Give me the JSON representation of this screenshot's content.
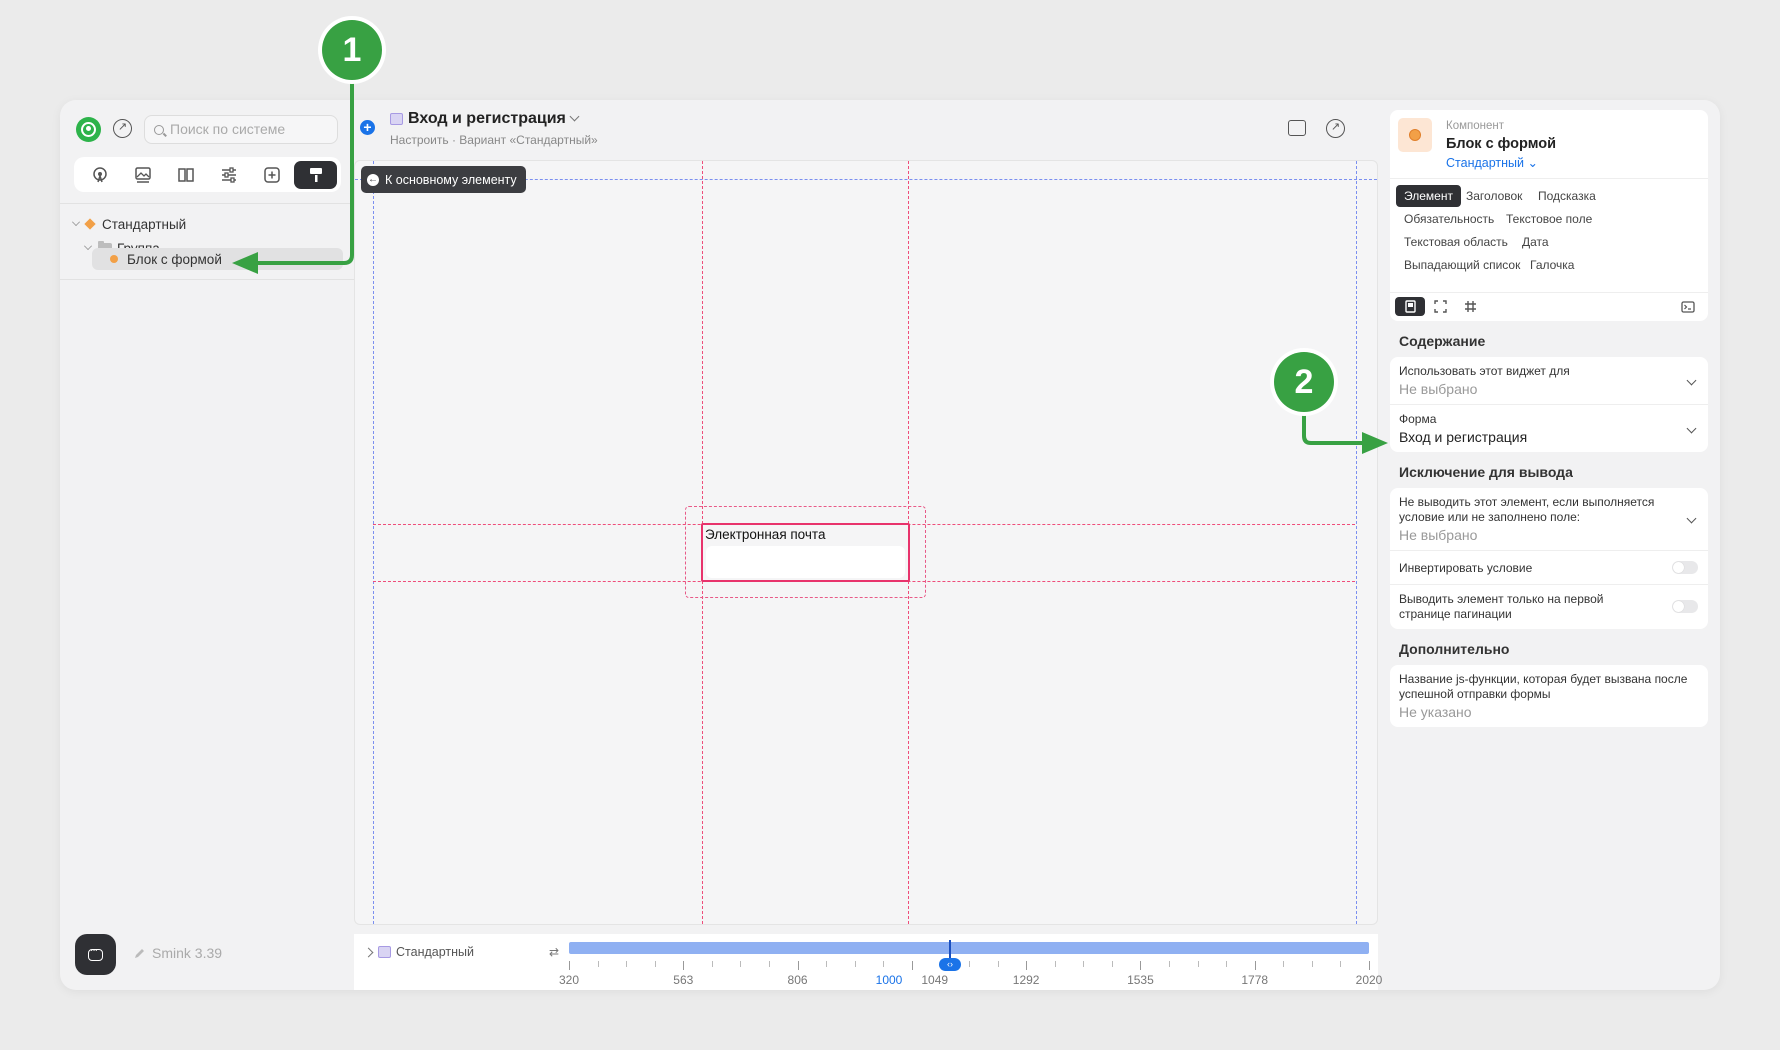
{
  "sidebar": {
    "search_placeholder": "Поиск по системе",
    "tree": [
      {
        "label": "Стандартный"
      },
      {
        "label": "Группа"
      },
      {
        "label": "Блок с формой"
      }
    ],
    "version": "Smink 3.39"
  },
  "header": {
    "title": "Вход и регистрация",
    "breadcrumb": "Настроить · Вариант «Стандартный»"
  },
  "canvas": {
    "back_button": "К основному элементу",
    "field_label": "Электронная почта"
  },
  "breakpoints": {
    "variant_label": "Стандартный",
    "ticks": [
      "320",
      "563",
      "806",
      "1000",
      "1049",
      "1292",
      "1535",
      "1778",
      "2020"
    ],
    "current": "1000"
  },
  "panel": {
    "component_kind": "Компонент",
    "component_name": "Блок с формой",
    "variant": "Стандартный",
    "tabs": [
      "Элемент",
      "Заголовок",
      "Подсказка",
      "Обязательность",
      "Текстовое поле",
      "Текстовая область",
      "Дата",
      "Выпадающий список",
      "Галочка"
    ],
    "content_title": "Содержание",
    "use_widget_label": "Использовать этот виджет для",
    "use_widget_value": "Не выбрано",
    "form_label": "Форма",
    "form_value": "Вход и регистрация",
    "exclusion_title": "Исключение для вывода",
    "exclusion_label": "Не выводить этот элемент, если выполняется условие или не заполнено поле:",
    "exclusion_value": "Не выбрано",
    "invert_label": "Инвертировать условие",
    "first_page_label": "Выводить элемент только на первой странице пагинации",
    "extra_title": "Дополнительно",
    "js_label": "Название js-функции, которая будет вызвана после успешной отправки формы",
    "js_value": "Не указано"
  },
  "annotations": {
    "badge1": "1",
    "badge2": "2"
  },
  "colors": {
    "accent_green": "#38a143",
    "accent_blue": "#1a73e8",
    "selection_red": "#e8336c"
  }
}
